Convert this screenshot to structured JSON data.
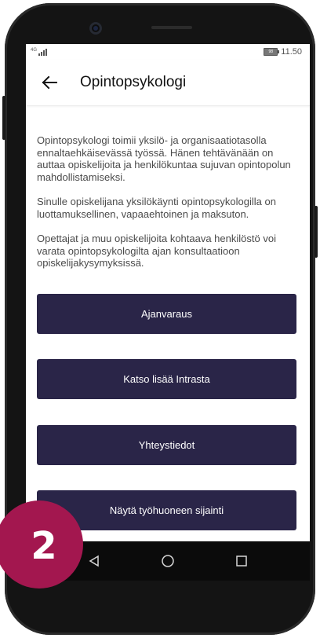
{
  "status_bar": {
    "network": "4G",
    "battery": "98",
    "time": "11.50"
  },
  "header": {
    "title": "Opintopsykologi",
    "back_icon": "arrow-left-icon"
  },
  "paragraphs": [
    "Opintopsykologi toimii yksilö- ja organisaatiotasolla ennaltaehkäisevässä työssä. Hänen tehtävänään on auttaa opiskelijoita ja henkilökuntaa sujuvan opintopolun mahdollistamiseksi.",
    "Sinulle opiskelijana yksilökäynti opintopsykologilla on luottamuksellinen, vapaaehtoinen ja maksuton.",
    "Opettajat ja muu opiskelijoita kohtaava henkilöstö voi varata opintopsykologilta ajan konsultaatioon opiskelijakysymyksissä."
  ],
  "buttons": [
    {
      "label": "Ajanvaraus"
    },
    {
      "label": "Katso lisää Intrasta"
    },
    {
      "label": "Yhteystiedot"
    },
    {
      "label": "Näytä työhuoneen sijainti"
    }
  ],
  "nav": {
    "back": "triangle-back-icon",
    "home": "circle-home-icon",
    "recents": "square-recents-icon"
  },
  "badge": {
    "number": "2",
    "color": "#a3174f"
  },
  "colors": {
    "button": "#2a2548",
    "text": "#4a4a4a"
  }
}
